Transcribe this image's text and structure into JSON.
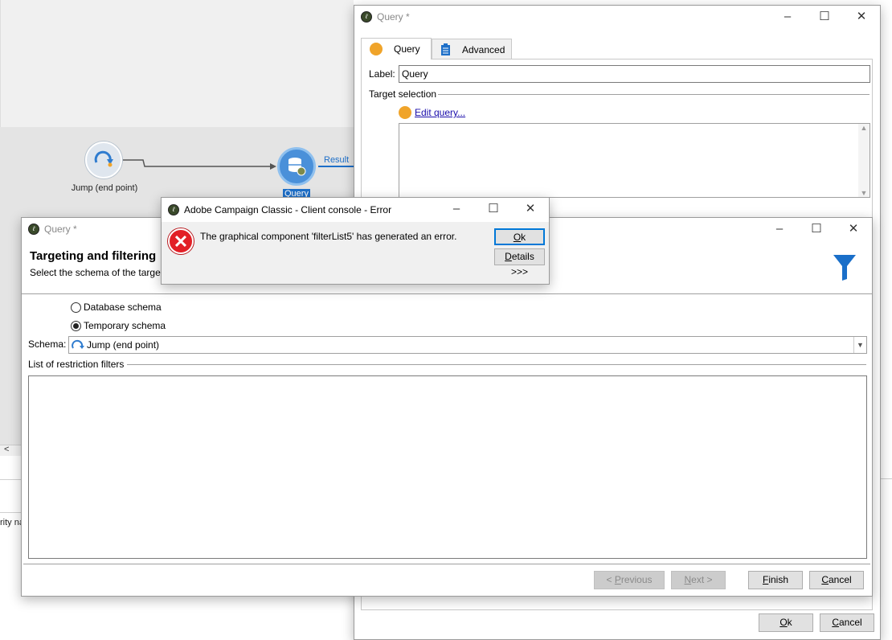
{
  "canvas": {
    "jump_node_label": "Jump (end point)",
    "query_node_label": "Query",
    "transition_label": "Result",
    "clipped_text": "rity na",
    "scroll_left_arrow": "<"
  },
  "query_window": {
    "title": "Query *",
    "tabs": [
      {
        "label": "Query"
      },
      {
        "label": "Advanced"
      }
    ],
    "label_caption": "Label:",
    "label_value": "Query",
    "target_selection_caption": "Target selection",
    "edit_query_link": "Edit query...",
    "buttons": {
      "ok": "Ok",
      "cancel": "Cancel"
    }
  },
  "wizard_window": {
    "title": "Query *",
    "heading": "Targeting and filtering",
    "subheading": "Select the schema of the target",
    "radio_options": [
      {
        "label": "Database schema",
        "checked": false
      },
      {
        "label": "Temporary schema",
        "checked": true
      }
    ],
    "schema_caption": "Schema:",
    "schema_value": "Jump (end point)",
    "filters_caption": "List of restriction filters",
    "buttons": {
      "previous": "< Previous",
      "next": "Next >",
      "finish": "Finish",
      "cancel": "Cancel"
    }
  },
  "error_dialog": {
    "title": "Adobe Campaign Classic - Client console - Error",
    "message": "The graphical component 'filterList5' has generated an error.",
    "ok_button": "Ok",
    "details_button": "Details >>>"
  },
  "window_controls": {
    "minimize": "–",
    "maximize": "☐",
    "close": "✕"
  },
  "colors": {
    "accent_blue": "#0078d7",
    "query_node": "#4a90d9",
    "filter_icon": "#1a6fc9",
    "error_red": "#e21f26",
    "link": "#1a0dab",
    "activity_orange": "#f0a42a"
  }
}
